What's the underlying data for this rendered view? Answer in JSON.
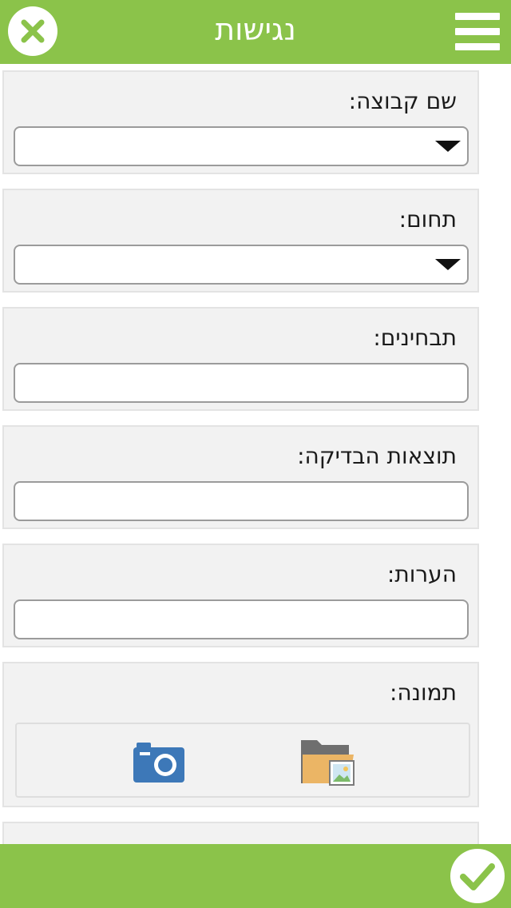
{
  "header": {
    "title": "נגישות",
    "close_icon": "close-icon",
    "menu_icon": "hamburger-menu-icon"
  },
  "form": {
    "group_name": {
      "label": "שם קבוצה:",
      "value": ""
    },
    "field": {
      "label": "תחום:",
      "value": ""
    },
    "findings": {
      "label": "תבחינים:",
      "value": ""
    },
    "test_results": {
      "label": "תוצאות הבדיקה:",
      "value": ""
    },
    "notes": {
      "label": "הערות:",
      "value": ""
    },
    "image": {
      "label": "תמונה:",
      "camera_icon": "camera-icon",
      "gallery_icon": "gallery-folder-icon"
    }
  },
  "footer": {
    "confirm_icon": "checkmark-icon"
  },
  "colors": {
    "brand_green": "#8bc34a",
    "camera_blue": "#3d78b8",
    "card_bg": "#f2f2f2"
  }
}
